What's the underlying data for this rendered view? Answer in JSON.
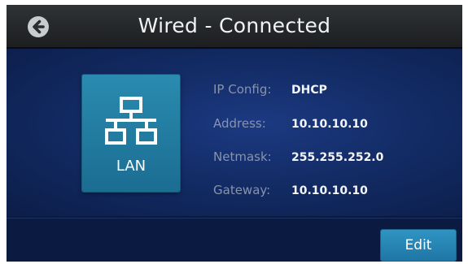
{
  "header": {
    "title": "Wired - Connected",
    "back_icon": "arrow-left-circle-icon"
  },
  "lan_tile": {
    "icon": "network-topology-icon",
    "label": "LAN"
  },
  "info": [
    {
      "label": "IP Config:",
      "value": "DHCP"
    },
    {
      "label": "Address:",
      "value": "10.10.10.10"
    },
    {
      "label": "Netmask:",
      "value": "255.255.252.0"
    },
    {
      "label": "Gateway:",
      "value": "10.10.10.10"
    }
  ],
  "footer": {
    "edit_label": "Edit"
  },
  "colors": {
    "title_bar": "#1c1e20",
    "background": "#132c66",
    "tile": "#2a8bb0",
    "button": "#2f94c2",
    "label_text": "#8893ad",
    "value_text": "#f3f5f8"
  }
}
